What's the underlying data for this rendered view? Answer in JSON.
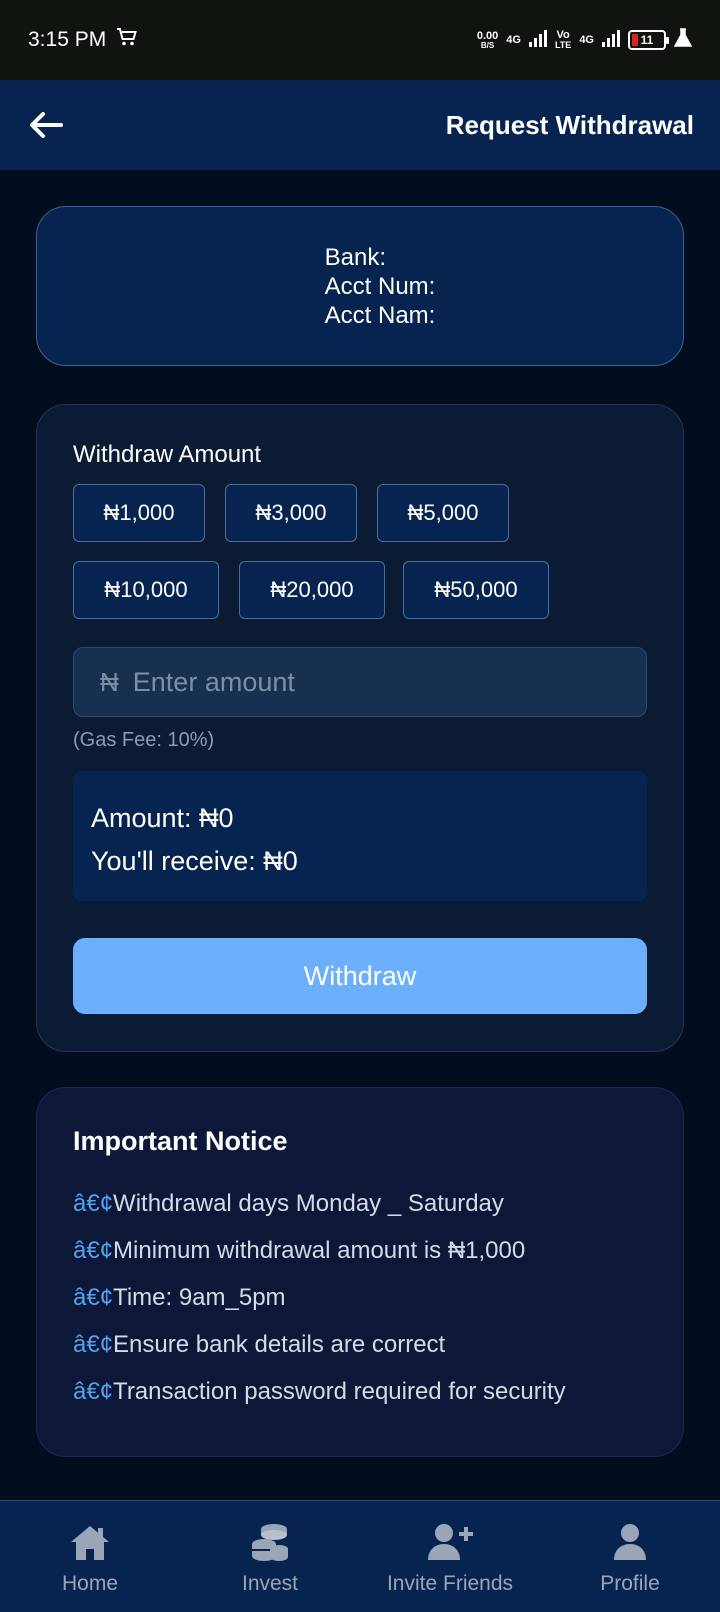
{
  "status_bar": {
    "time": "3:15 PM",
    "net_speed_value": "0.00",
    "net_speed_unit": "B/S",
    "net_type_1": "4G",
    "volte_top": "Vo",
    "volte_bottom": "LTE",
    "net_type_2": "4G",
    "battery": "11"
  },
  "header": {
    "title": "Request Withdrawal"
  },
  "bank": {
    "bank_label": "Bank:",
    "acct_num_label": "Acct Num:",
    "acct_name_label": "Acct Nam:"
  },
  "withdraw": {
    "label": "Withdraw Amount",
    "presets": [
      "₦1,000",
      "₦3,000",
      "₦5,000",
      "₦10,000",
      "₦20,000",
      "₦50,000"
    ],
    "currency_symbol": "₦",
    "input_placeholder": "Enter amount",
    "input_value": "",
    "gas_fee": "(Gas Fee: 10%)",
    "amount_line": "Amount: ₦0",
    "receive_line": "You'll receive: ₦0",
    "button_label": "Withdraw"
  },
  "notice": {
    "title": "Important Notice",
    "bullet": "â€¢",
    "items": [
      "Withdrawal days Monday _ Saturday",
      "Minimum withdrawal amount is ₦1,000",
      "Time: 9am_5pm",
      "Ensure bank details are correct",
      "Transaction password required for security"
    ]
  },
  "nav": {
    "items": [
      {
        "label": "Home",
        "icon": "home-icon"
      },
      {
        "label": "Invest",
        "icon": "coins-icon"
      },
      {
        "label": "Invite Friends",
        "icon": "add-user-icon"
      },
      {
        "label": "Profile",
        "icon": "profile-icon"
      }
    ]
  },
  "colors": {
    "header_bg": "#06244f",
    "page_bg": "#020d1f",
    "button_bg": "#6cb0fb",
    "bullet": "#4fa3f0"
  }
}
